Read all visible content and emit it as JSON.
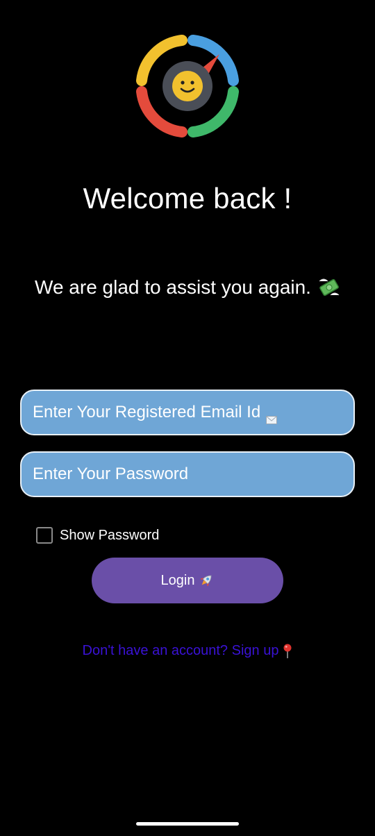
{
  "header": {
    "title": "Welcome back !",
    "subtitle": "We are glad to assist you again."
  },
  "form": {
    "email_placeholder": "Enter Your Registered Email Id",
    "password_placeholder": "Enter Your Password",
    "show_password_label": "Show Password",
    "show_password_checked": false,
    "login_label": "Login"
  },
  "footer": {
    "signup_text": "Don't have an account? Sign up"
  },
  "icons": {
    "logo": "smiley-compass-logo-icon",
    "subtitle_emoji": "money-with-wings-icon",
    "email_emoji": "envelope-icon",
    "login_emoji": "rocket-icon",
    "signup_emoji": "round-pushpin-icon"
  },
  "colors": {
    "background": "#000000",
    "input_fill": "#6fa6d6",
    "input_border": "#e9f1f8",
    "login_button": "#6a4fa8",
    "signup_link": "#3a12d6",
    "logo_yellow": "#f2c12e",
    "logo_blue": "#4a9fe0",
    "logo_red": "#e44b3c",
    "logo_green": "#3fb86a",
    "logo_center": "#4a4e57"
  }
}
